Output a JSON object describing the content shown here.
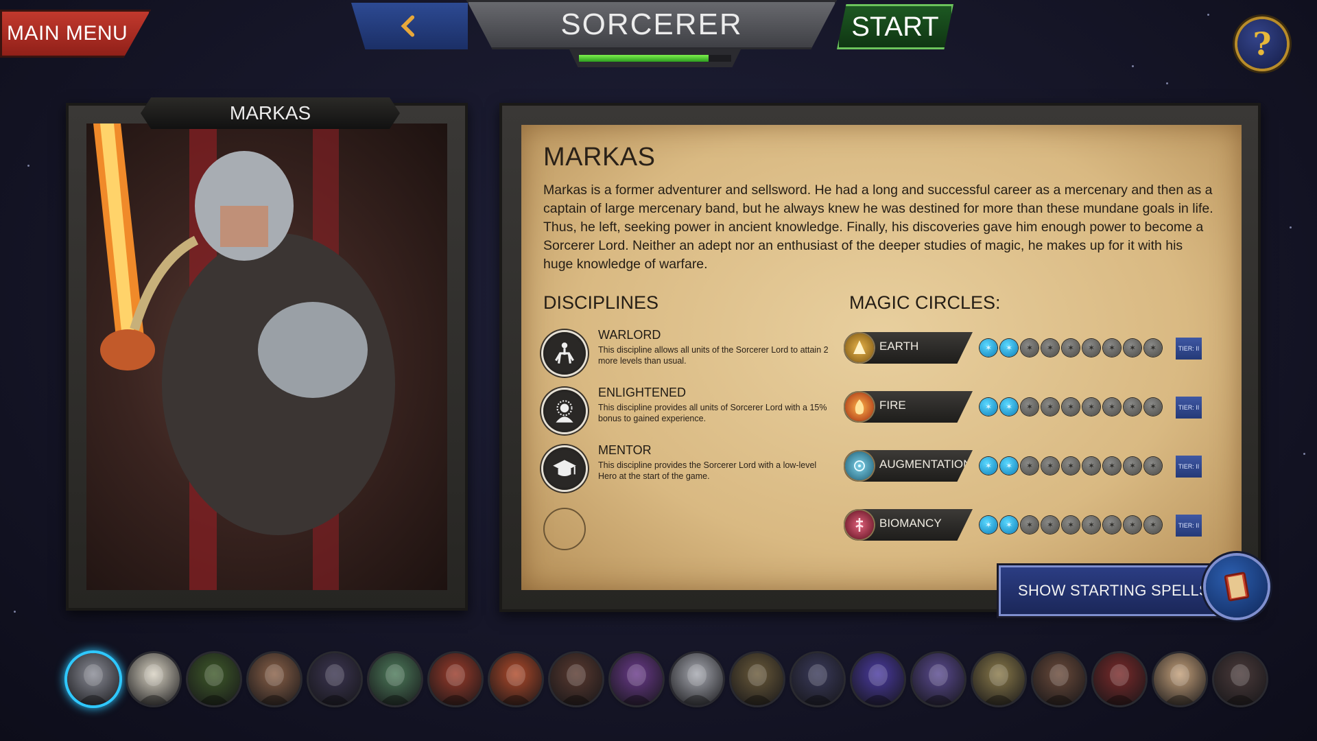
{
  "header": {
    "main_menu_label": "MAIN MENU",
    "class_title": "SORCERER",
    "start_label": "START",
    "help_symbol": "?",
    "progress_fraction": 0.85
  },
  "portrait": {
    "name": "MARKAS"
  },
  "info": {
    "title": "MARKAS",
    "description": "Markas is a former adventurer and sellsword. He had a long and successful career as a mercenary and then as a captain of large mercenary band, but he always knew he was destined for more than these mundane goals in life. Thus, he left, seeking power in ancient knowledge. Finally, his discoveries gave him enough power to become a Sorcerer Lord. Neither an adept nor an enthusiast of the deeper studies of magic, he makes up for it with his huge knowledge of warfare.",
    "disciplines_heading": "DISCIPLINES",
    "magic_circles_heading": "MAGIC CIRCLES:",
    "disciplines": [
      {
        "name": "WARLORD",
        "text": "This discipline allows all units of the Sorcerer Lord to attain 2 more levels than usual.",
        "icon": "horse-rider-icon"
      },
      {
        "name": "ENLIGHTENED",
        "text": "This discipline provides all units of Sorcerer Lord with a 15% bonus to gained experience.",
        "icon": "enlightened-head-icon"
      },
      {
        "name": "MENTOR",
        "text": "This discipline provides the Sorcerer Lord with a low-level Hero at the start of the game.",
        "icon": "graduation-cap-icon"
      }
    ],
    "magic_circles": [
      {
        "name": "EARTH",
        "tier": "TIER: II",
        "active_pips": 2,
        "total_pips": 9,
        "color": "#c9902a",
        "icon": "earth-icon"
      },
      {
        "name": "FIRE",
        "tier": "TIER: II",
        "active_pips": 2,
        "total_pips": 9,
        "color": "#e0541f",
        "icon": "fire-icon"
      },
      {
        "name": "AUGMENTATION",
        "tier": "TIER: II",
        "active_pips": 2,
        "total_pips": 9,
        "color": "#3a8fae",
        "icon": "augmentation-icon"
      },
      {
        "name": "BIOMANCY",
        "tier": "TIER: II",
        "active_pips": 2,
        "total_pips": 9,
        "color": "#a3243b",
        "icon": "biomancy-icon"
      }
    ],
    "show_spells_label": "SHOW STARTING SPELLS"
  },
  "roster": {
    "count": 20,
    "selected_index": 0,
    "colors": [
      "#8a8c96",
      "#d8d2c2",
      "#3f5a2a",
      "#8a6148",
      "#3b3550",
      "#4d7a5a",
      "#9a3b2a",
      "#b04a2a",
      "#5a3a30",
      "#6a3a8a",
      "#a6a8b0",
      "#6a5a3a",
      "#3a3a5a",
      "#4a3aa0",
      "#5a4a90",
      "#8a7a4a",
      "#6a4a3a",
      "#7a2a2a",
      "#c4a07a",
      "#4a3a3a"
    ]
  },
  "colors": {
    "accent_green": "#2c9d1f",
    "accent_blue": "#2c3e85",
    "danger_red": "#c43a2e",
    "highlight_cyan": "#2fc8ff"
  }
}
